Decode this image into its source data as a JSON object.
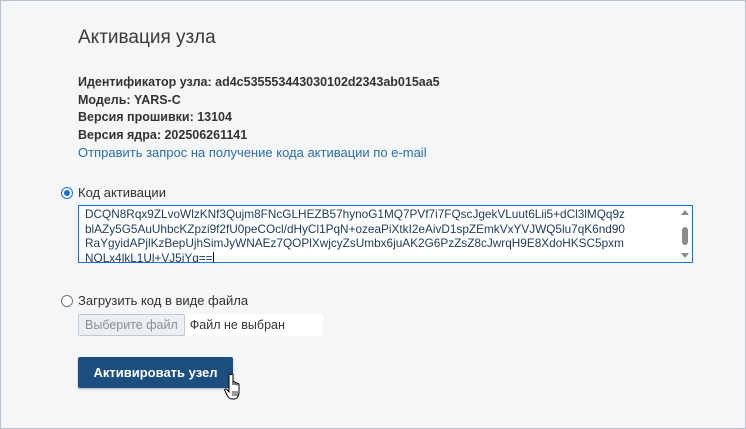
{
  "page": {
    "title": "Активация узла"
  },
  "node_info": {
    "id_line": "Идентификатор узла: ad4c535553443030102d2343ab015aa5",
    "model_line": "Модель: YARS-C",
    "firmware_line": "Версия прошивки: 13104",
    "kernel_line": "Версия ядра: 202506261141"
  },
  "request_link": "Отправить запрос на получение кода активации по e-mail",
  "activation_code": {
    "label": "Код активации",
    "selected": true,
    "lines": [
      "DCQN8Rqx9ZLvoWlzKNf3Qujm8FNcGLHEZB57hynoG1MQ7PVf7i7FQscJgekVLuut6Lii5+dCl3lMQq9z",
      "blAZy5G5AuUhbcKZpzi9f2fU0peCOcl/dHyCl1PqN+ozeaPiXtkI2eAivD1spZEmkVxYVJWQ5lu7qK6nd90",
      "RaYgyidAPjlKzBepUjhSimJyWNAEz7QOPlXwjcyZsUmbx6juAK2G6PzZsZ8cJwrqH9E8XdoHKSC5pxm",
      "NOLx4lkL1Ul+VJ5iYg=="
    ],
    "scrollbar": {
      "up_icon": "triangle-up",
      "down_icon": "triangle-down"
    }
  },
  "upload_file": {
    "label": "Загрузить код в виде файла",
    "selected": false,
    "choose_button": "Выберите файл",
    "status": "Файл не выбран"
  },
  "activate_button": "Активировать узел",
  "colors": {
    "accent": "#1a6fd6",
    "button_bg": "#1c4e80",
    "link": "#2d6da8",
    "background": "#f4f6f8"
  },
  "cursor_icon": "hand-pointer-icon"
}
